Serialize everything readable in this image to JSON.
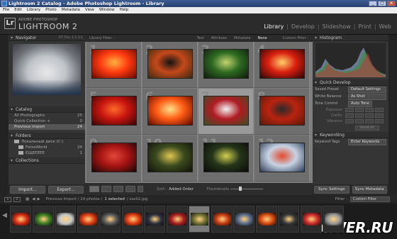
{
  "window": {
    "title": "Lightroom 2 Catalog - Adobe Photoshop Lightroom - Library"
  },
  "menu": [
    "File",
    "Edit",
    "Library",
    "Photo",
    "Metadata",
    "View",
    "Window",
    "Help"
  ],
  "header": {
    "logo_letters": "Lr",
    "brand_small": "ADOBE PHOTOSHOP",
    "brand_big": "LIGHTROOM 2",
    "modules": [
      "Library",
      "Develop",
      "Slideshow",
      "Print",
      "Web"
    ],
    "active_module": "Library"
  },
  "left": {
    "navigator": {
      "title": "Navigator",
      "zoom_options": "FIT  FILL  1:1  3:1"
    },
    "catalog": {
      "title": "Catalog",
      "items": [
        {
          "label": "All Photographs",
          "count": "25"
        },
        {
          "label": "Quick Collection +",
          "count": "0"
        },
        {
          "label": "Previous Import",
          "count": "24"
        }
      ]
    },
    "folders": {
      "title": "Folders",
      "volume": {
        "label": "Локальный диск (C:)",
        "count": ""
      },
      "items": [
        {
          "label": "FotosWorld",
          "count": "24"
        },
        {
          "label": "ЕЩЕЕЕЕЕ",
          "count": "1"
        }
      ]
    },
    "collections": {
      "title": "Collections"
    },
    "import_label": "Import...",
    "export_label": "Export..."
  },
  "filter": {
    "label": "Library Filter :",
    "tabs": [
      "Text",
      "Attribute",
      "Metadata",
      "None"
    ],
    "active_tab": "None",
    "preset": "Custom Filter :"
  },
  "grid": {
    "cells": [
      {
        "num": "1",
        "colors": [
          "#ff3b10",
          "#ffb040",
          "#6a0800"
        ]
      },
      {
        "num": "2",
        "colors": [
          "#c5491a",
          "#141414",
          "#3b2a10"
        ]
      },
      {
        "num": "3",
        "colors": [
          "#2e6b22",
          "#c3d470",
          "#0e1a0b"
        ]
      },
      {
        "num": "4",
        "colors": [
          "#d91f0f",
          "#ffce6a",
          "#2a0505"
        ]
      },
      {
        "num": "5",
        "colors": [
          "#c8150f",
          "#ff6a2b",
          "#3a0604"
        ]
      },
      {
        "num": "6",
        "colors": [
          "#ff5a14",
          "#ffe28a",
          "#5c0a00"
        ]
      },
      {
        "num": "7",
        "colors": [
          "#b01b23",
          "#f2f2f2",
          "#3d5024"
        ]
      },
      {
        "num": "8",
        "colors": [
          "#b9230f",
          "#2a2a2a",
          "#5a1a0c"
        ]
      },
      {
        "num": "9",
        "colors": [
          "#a81513",
          "#e3473a",
          "#1a0606"
        ]
      },
      {
        "num": "10",
        "colors": [
          "#3c4b1f",
          "#e0c650",
          "#101208"
        ]
      },
      {
        "num": "11",
        "colors": [
          "#26361a",
          "#d0d050",
          "#0a0a08"
        ]
      },
      {
        "num": "12",
        "colors": [
          "#c8d3e3",
          "#e04a2d",
          "#2a3a55"
        ]
      }
    ],
    "selected_index": 6
  },
  "right": {
    "histogram": {
      "title": "Histogram"
    },
    "quick_develop": {
      "title": "Quick Develop",
      "saved_preset": {
        "label": "Saved Preset",
        "value": "Default Settings"
      },
      "white_balance": {
        "label": "White Balance",
        "value": "As Shot"
      },
      "tone_control": {
        "label": "Tone Control",
        "value": "Auto Tone"
      },
      "rows": [
        "Exposure",
        "Clarity",
        "Vibrance"
      ],
      "reset": "Reset All"
    },
    "keywording": {
      "title": "Keywording",
      "tags": {
        "label": "Keyword Tags",
        "value": "Enter Keywords"
      }
    },
    "sync_settings": "Sync Settings",
    "sync_metadata": "Sync Metadata"
  },
  "toolbar": {
    "sort_label": "Sort:",
    "sort_value": "Added Order",
    "thumbnails_label": "Thumbnails"
  },
  "filmstrip": {
    "page1": "1",
    "page2": "2",
    "path": "Previous Import / 24 photos /",
    "selection": "1 selected",
    "filename": "/ zazil2.jpg",
    "filter_label": "Filter :",
    "filter_value": "Custom Filter",
    "thumbs": [
      "#d42a12",
      "#3c7a22",
      "#c8c8c8",
      "#d93a12",
      "#5a5a5a",
      "#e03a12",
      "#2d3240",
      "#a82020",
      "#6e6e30",
      "#c43a10",
      "#5c6e8a",
      "#d84a10",
      "#3a3a3a",
      "#cc2a2a",
      "#9a9a9a"
    ],
    "selected_index": 8
  },
  "watermark": "CWER.RU"
}
